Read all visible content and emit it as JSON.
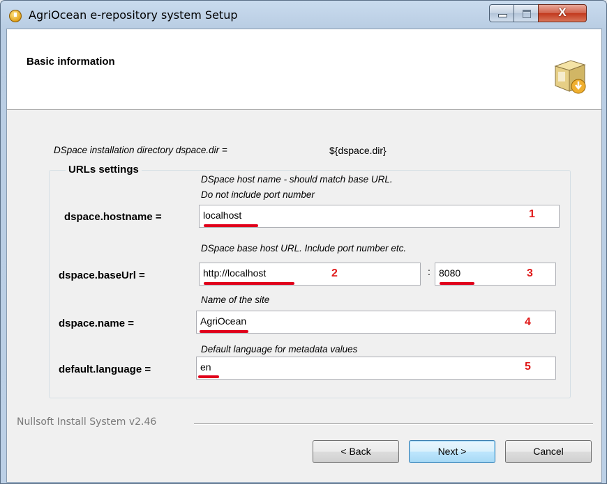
{
  "window": {
    "title": "AgriOcean e-repository system Setup",
    "close_glyph": "X"
  },
  "header": {
    "title": "Basic information",
    "icon": "installer-box-icon"
  },
  "install_dir": {
    "label": "DSpace installation directory dspace.dir =",
    "value": "${dspace.dir}"
  },
  "group": {
    "title": "URLs settings"
  },
  "fields": {
    "hostname": {
      "hint1": "DSpace host name - should match base URL.",
      "hint2": "Do not include port number",
      "label": "dspace.hostname =",
      "value": "localhost",
      "marker": "1"
    },
    "baseurl": {
      "hint": "DSpace base host URL.  Include port number etc.",
      "label": "dspace.baseUrl  =",
      "value": "http://localhost",
      "marker": "2",
      "sep": ":",
      "port": "8080",
      "port_marker": "3"
    },
    "name": {
      "hint": "Name of the site",
      "label": "dspace.name  =",
      "value": "AgriOcean",
      "marker": "4"
    },
    "language": {
      "hint": "Default language for metadata values",
      "label": "default.language =",
      "value": "en",
      "marker": "5"
    }
  },
  "footer": {
    "brand": "Nullsoft Install System v2.46"
  },
  "buttons": {
    "back": "< Back",
    "next": "Next >",
    "cancel": "Cancel"
  },
  "colors": {
    "annotation": "#e0001b"
  }
}
